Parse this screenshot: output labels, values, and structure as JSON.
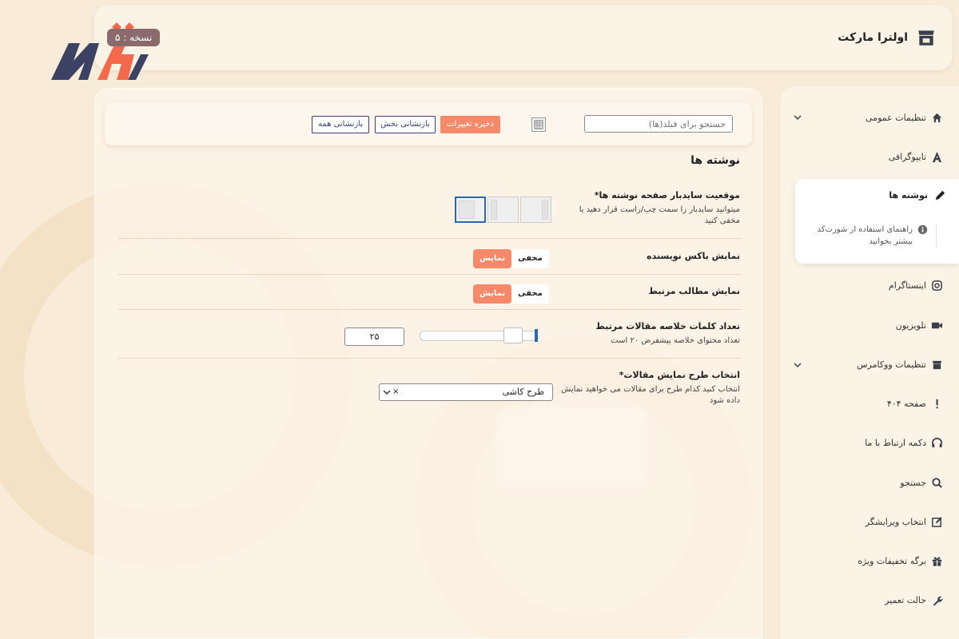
{
  "header": {
    "brand_title": "اولترا مارکت",
    "version_badge": "نسخه : ۵"
  },
  "toolbar": {
    "search_placeholder": "جستجو برای فیلد(ها)",
    "save_label": "ذخیره تغییرات",
    "reset_section_label": "بازنشانی بخش",
    "reset_all_label": "بازنشانی همه"
  },
  "sidebar": {
    "items": [
      {
        "label": "تنظیمات عمومی",
        "icon": "home-icon",
        "has_children": true
      },
      {
        "label": "تایپوگرافی",
        "icon": "typography-icon",
        "has_children": false
      },
      {
        "label": "نوشته ها",
        "icon": "pencil-icon",
        "active": true
      },
      {
        "label": "اینستاگرام",
        "icon": "instagram-icon",
        "has_children": false
      },
      {
        "label": "تلویزیون",
        "icon": "video-icon",
        "has_children": false
      },
      {
        "label": "تنظیمات ووکامرس",
        "icon": "store-icon",
        "has_children": true
      },
      {
        "label": "صفحه ۴۰۴",
        "icon": "exclamation-icon",
        "has_children": false
      },
      {
        "label": "دکمه ارتباط با ما",
        "icon": "headphones-icon",
        "has_children": false
      },
      {
        "label": "جستجو",
        "icon": "search-icon",
        "has_children": false
      },
      {
        "label": "انتخاب ویرایشگر",
        "icon": "edit-icon",
        "has_children": false
      },
      {
        "label": "برگه تخفیفات ویژه",
        "icon": "gift-icon",
        "has_children": false
      },
      {
        "label": "حالت تعمیر",
        "icon": "wrench-icon",
        "has_children": false
      }
    ],
    "active_sub": "راهنمای استفاده از شورت‌کد بیشتر بخوانید"
  },
  "main": {
    "section_title": "نوشته ها",
    "sidebar_position": {
      "label": "موقعیت سایدبار صفحه نوشته ها*",
      "desc": "میتوانید سایدبار را سمت چپ/راست قرار دهید یا مخفی کنید",
      "selected": "left"
    },
    "author_box": {
      "label": "نمایش باکس نویسنده",
      "on_label": "نمایش",
      "off_label": "مخفی",
      "value": "show"
    },
    "related_posts": {
      "label": "نمایش مطالب مرتبط",
      "on_label": "نمایش",
      "off_label": "مخفی",
      "value": "show"
    },
    "excerpt_words": {
      "label": "تعداد کلمات خلاصه مقالات مرتبط",
      "desc": "تعداد محتوای خلاصه پیشفرض ۲۰ است",
      "value": "۲۵",
      "slider_fraction": 0.85
    },
    "layout_select": {
      "label": "انتخاب طرح نمایش مقالات*",
      "desc": "انتخاب کنید کدام طرح برای مقالات می خواهید نمایش داده شود",
      "value": "طرح کاشی",
      "clear": "×"
    }
  },
  "colors": {
    "accent": "#f58a6b",
    "outline": "#3a3f7a",
    "selected": "#2a6aa8"
  }
}
